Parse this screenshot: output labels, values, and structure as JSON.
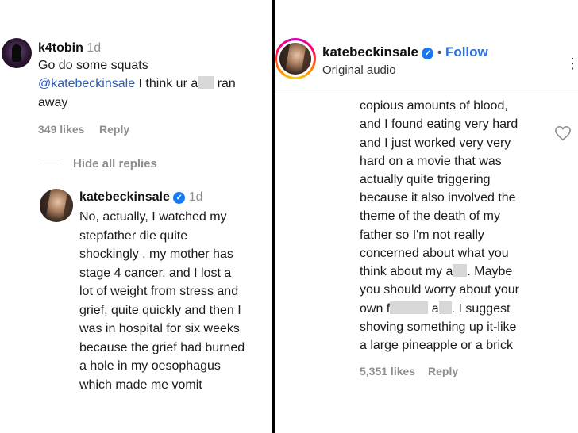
{
  "left": {
    "comment": {
      "username": "k4tobin",
      "time": "1d",
      "line1": "Go do some squats",
      "mention": "@katebeckinsale",
      "line2_rest": " I think ur a",
      "line2_end": " ran",
      "line3": "away",
      "likes": "349 likes",
      "reply": "Reply"
    },
    "hide_replies": "Hide all replies",
    "reply": {
      "username": "katebeckinsale",
      "time": "1d",
      "lines": [
        "No, actually, I watched my",
        "stepfather die quite",
        "shockingly , my mother has",
        "stage 4 cancer, and I lost a",
        "lot of weight from stress and",
        "grief, quite quickly and then I",
        "was in hospital for six weeks",
        "because the grief had burned",
        "a hole in my oesophagus",
        "which made me vomit"
      ]
    }
  },
  "right": {
    "header": {
      "username": "katebeckinsale",
      "bullet": "•",
      "follow": "Follow",
      "subtitle": "Original audio",
      "more": "⋮"
    },
    "lines": [
      "copious amounts of blood,",
      "and I found eating very hard",
      "and I just worked very very",
      "hard on a movie that was",
      "actually quite triggering",
      "because it also involved the",
      "theme of the death of my",
      "father so I'm not really",
      "concerned about what you",
      "think about my a",
      ". Maybe",
      "you should worry about your",
      "own f",
      " a",
      ". I suggest",
      "shoving something up it-like",
      "a large pineapple or a brick"
    ],
    "likes": "5,351 likes",
    "reply": "Reply"
  },
  "colors": {
    "link": "#2a5bb7",
    "follow": "#2a6fdb",
    "verified": "#1877f2",
    "muted": "#8e8e8e"
  }
}
